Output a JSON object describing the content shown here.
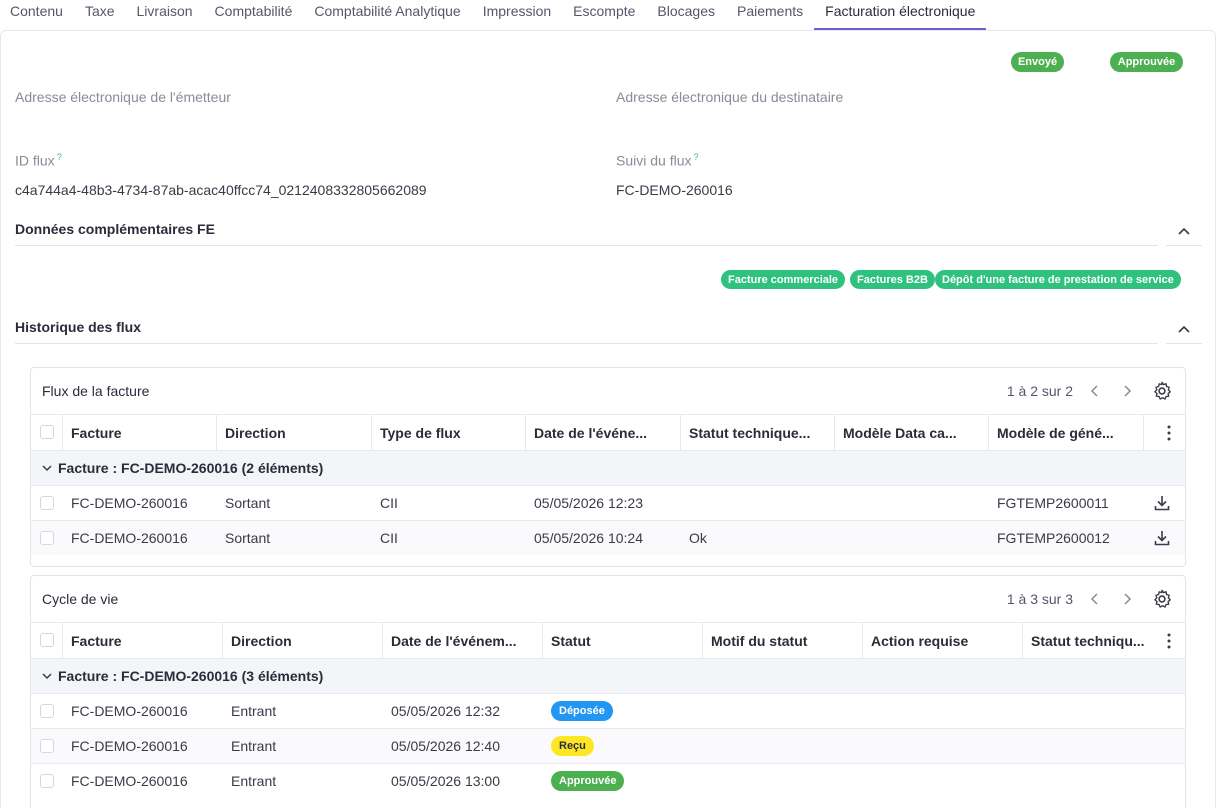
{
  "tabs": [
    "Contenu",
    "Taxe",
    "Livraison",
    "Comptabilité",
    "Comptabilité Analytique",
    "Impression",
    "Escompte",
    "Blocages",
    "Paiements",
    "Facturation électronique"
  ],
  "status_badges": {
    "sent": "Envoyé",
    "approved": "Approuvée"
  },
  "fields": {
    "sender_label": "Adresse électronique de l'émetteur",
    "recipient_label": "Adresse électronique du destinataire",
    "flow_id_label": "ID flux",
    "flow_id_value": "c4a744a4-48b3-4734-87ab-acac40ffcc74_0212408332805662089",
    "tracking_label": "Suivi du flux",
    "tracking_value": "FC-DEMO-260016",
    "help_mark": "?"
  },
  "section_fe": {
    "title": "Données complémentaires FE",
    "chips": [
      "Facture commerciale",
      "Factures B2B",
      "Dépôt d'une facture de prestation de service"
    ]
  },
  "section_history": {
    "title": "Historique des flux"
  },
  "flux_grid": {
    "title": "Flux de la facture",
    "pager": "1 à 2 sur 2",
    "columns": [
      "Facture",
      "Direction",
      "Type de flux",
      "Date de l'événe...",
      "Statut technique...",
      "Modèle Data ca...",
      "Modèle de géné..."
    ],
    "group": "Facture : FC-DEMO-260016 (2 éléments)",
    "rows": [
      [
        "FC-DEMO-260016",
        "Sortant",
        "CII",
        "05/05/2026 12:23",
        "",
        "",
        "FGTEMP2600011"
      ],
      [
        "FC-DEMO-260016",
        "Sortant",
        "CII",
        "05/05/2026 10:24",
        "Ok",
        "",
        "FGTEMP2600012"
      ]
    ]
  },
  "cycle_grid": {
    "title": "Cycle de vie",
    "pager": "1 à 3 sur 3",
    "columns": [
      "Facture",
      "Direction",
      "Date de l'événem...",
      "Statut",
      "Motif du statut",
      "Action requise",
      "Statut techniqu..."
    ],
    "group": "Facture : FC-DEMO-260016 (3 éléments)",
    "rows": [
      {
        "facture": "FC-DEMO-260016",
        "direction": "Entrant",
        "date": "05/05/2026 12:32",
        "statut": "Déposée",
        "color": "blue"
      },
      {
        "facture": "FC-DEMO-260016",
        "direction": "Entrant",
        "date": "05/05/2026 12:40",
        "statut": "Reçu",
        "color": "yellow"
      },
      {
        "facture": "FC-DEMO-260016",
        "direction": "Entrant",
        "date": "05/05/2026 13:00",
        "statut": "Approuvée",
        "color": "green"
      }
    ]
  },
  "colors": {
    "accent": "#6c63c8",
    "green": "#4caf50",
    "teal": "#2ec27e",
    "blue": "#2196f3",
    "yellow": "#fde725"
  },
  "icons": [
    "chevron-up-icon",
    "chevron-left-icon",
    "chevron-right-icon",
    "gear-icon",
    "kebab-icon",
    "download-icon",
    "chevron-down-icon"
  ]
}
